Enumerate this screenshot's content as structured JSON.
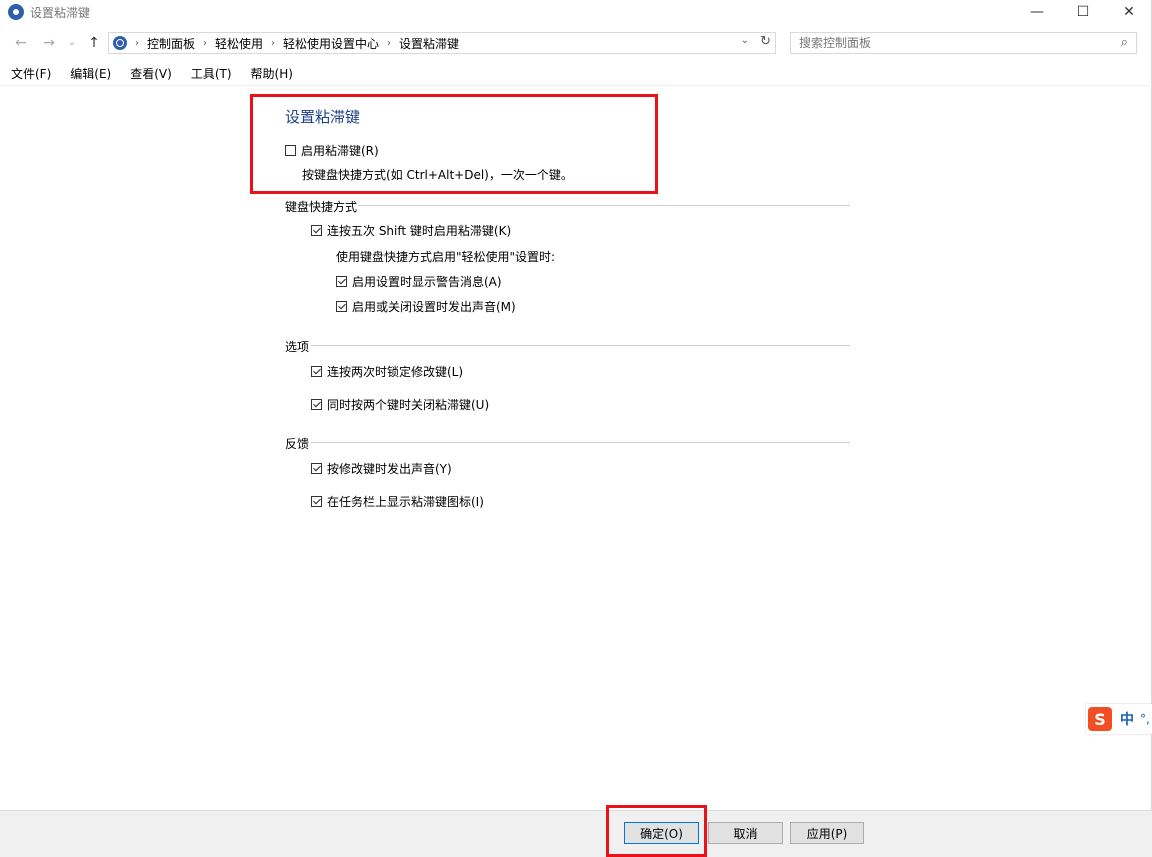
{
  "window": {
    "title": "设置粘滞键",
    "minimize_glyph": "—",
    "maximize_glyph": "☐",
    "close_glyph": "✕"
  },
  "nav": {
    "back_glyph": "←",
    "forward_glyph": "→",
    "recent_glyph": "⌄",
    "up_glyph": "↑",
    "breadcrumbs": [
      "控制面板",
      "轻松使用",
      "轻松使用设置中心",
      "设置粘滞键"
    ],
    "crumb_sep": "›",
    "dropdown_glyph": "⌄",
    "refresh_glyph": "↻",
    "search_placeholder": "搜索控制面板",
    "search_glyph": "⌕"
  },
  "menu": [
    "文件(F)",
    "编辑(E)",
    "查看(V)",
    "工具(T)",
    "帮助(H)"
  ],
  "content": {
    "title": "设置粘滞键",
    "enable": {
      "label": "启用粘滞键(R)",
      "checked": false
    },
    "enable_desc": "按键盘快捷方式(如 Ctrl+Alt+Del)，一次一个键。",
    "sections": {
      "shortcut": {
        "label": "键盘快捷方式",
        "shift5": {
          "label": "连按五次 Shift 键时启用粘滞键(K)",
          "checked": true
        },
        "sub_desc": "使用键盘快捷方式启用\"轻松使用\"设置时:",
        "warn": {
          "label": "启用设置时显示警告消息(A)",
          "checked": true
        },
        "sound": {
          "label": "启用或关闭设置时发出声音(M)",
          "checked": true
        }
      },
      "options": {
        "label": "选项",
        "lock": {
          "label": "连按两次时锁定修改键(L)",
          "checked": true
        },
        "turnoff": {
          "label": "同时按两个键时关闭粘滞键(U)",
          "checked": true
        }
      },
      "feedback": {
        "label": "反馈",
        "beep": {
          "label": "按修改键时发出声音(Y)",
          "checked": true
        },
        "taskbar": {
          "label": "在任务栏上显示粘滞键图标(I)",
          "checked": true
        }
      }
    }
  },
  "buttons": {
    "ok": "确定(O)",
    "cancel": "取消",
    "apply": "应用(P)"
  },
  "ime": {
    "logo": "S",
    "mode": "中",
    "punct": "°,"
  },
  "colors": {
    "title_blue": "#1e3f87",
    "highlight_red": "#e8121b",
    "ime_orange": "#ef4f22"
  }
}
